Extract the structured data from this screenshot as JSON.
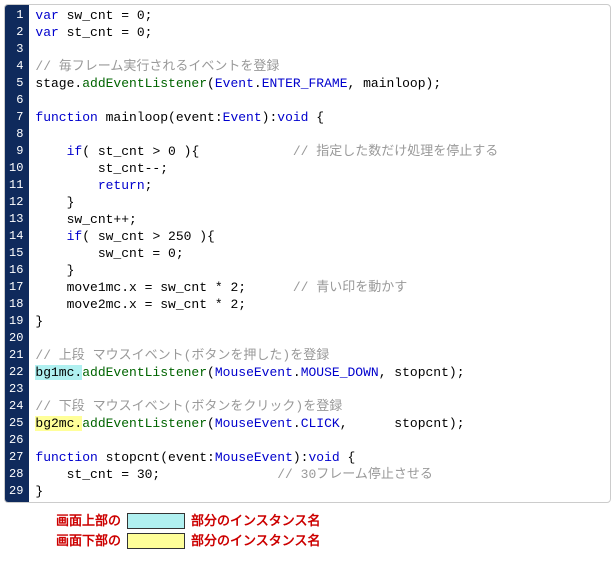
{
  "lines": [
    {
      "n": 1,
      "html": "<span class=\"kw\">var</span> sw_cnt = 0;"
    },
    {
      "n": 2,
      "html": "<span class=\"kw\">var</span> st_cnt = 0;"
    },
    {
      "n": 3,
      "html": ""
    },
    {
      "n": 4,
      "html": "<span class=\"cm\">// 毎フレーム実行されるイベントを登録</span>"
    },
    {
      "n": 5,
      "html": "stage.<span class=\"fn\">addEventListener</span>(<span class=\"const\">Event</span>.<span class=\"const\">ENTER_FRAME</span>, mainloop);"
    },
    {
      "n": 6,
      "html": ""
    },
    {
      "n": 7,
      "html": "<span class=\"kw\">function</span> mainloop(event:<span class=\"const\">Event</span>):<span class=\"kw\">void</span> {"
    },
    {
      "n": 8,
      "html": ""
    },
    {
      "n": 9,
      "html": "    <span class=\"kw\">if</span>( st_cnt &gt; 0 ){            <span class=\"cm\">// 指定した数だけ処理を停止する</span>"
    },
    {
      "n": 10,
      "html": "        st_cnt--;"
    },
    {
      "n": 11,
      "html": "        <span class=\"kw\">return</span>;"
    },
    {
      "n": 12,
      "html": "    }"
    },
    {
      "n": 13,
      "html": "    sw_cnt++;"
    },
    {
      "n": 14,
      "html": "    <span class=\"kw\">if</span>( sw_cnt &gt; 250 ){"
    },
    {
      "n": 15,
      "html": "        sw_cnt = 0;"
    },
    {
      "n": 16,
      "html": "    }"
    },
    {
      "n": 17,
      "html": "    move1mc.x = sw_cnt * 2;      <span class=\"cm\">// 青い印を動かす</span>"
    },
    {
      "n": 18,
      "html": "    move2mc.x = sw_cnt * 2;"
    },
    {
      "n": 19,
      "html": "}"
    },
    {
      "n": 20,
      "html": ""
    },
    {
      "n": 21,
      "html": "<span class=\"cm\">// 上段 マウスイベント(ボタンを押した)を登録</span>"
    },
    {
      "n": 22,
      "html": "<span class=\"hl-cyan\">bg1mc.</span><span class=\"fn\">addEventListener</span>(<span class=\"const\">MouseEvent</span>.<span class=\"const\">MOUSE_DOWN</span>, stopcnt);"
    },
    {
      "n": 23,
      "html": ""
    },
    {
      "n": 24,
      "html": "<span class=\"cm\">// 下段 マウスイベント(ボタンをクリック)を登録</span>"
    },
    {
      "n": 25,
      "html": "<span class=\"hl-yellow\">bg2mc.</span><span class=\"fn\">addEventListener</span>(<span class=\"const\">MouseEvent</span>.<span class=\"const\">CLICK</span>,      stopcnt);"
    },
    {
      "n": 26,
      "html": ""
    },
    {
      "n": 27,
      "html": "<span class=\"kw\">function</span> stopcnt(event:<span class=\"const\">MouseEvent</span>):<span class=\"kw\">void</span> {"
    },
    {
      "n": 28,
      "html": "    st_cnt = 30;               <span class=\"cm\">// 30フレーム停止させる</span>"
    },
    {
      "n": 29,
      "html": "}"
    }
  ],
  "legend": {
    "row1_prefix": "画面上部の",
    "row1_suffix": "部分のインスタンス名",
    "row2_prefix": "画面下部の",
    "row2_suffix": "部分のインスタンス名"
  }
}
